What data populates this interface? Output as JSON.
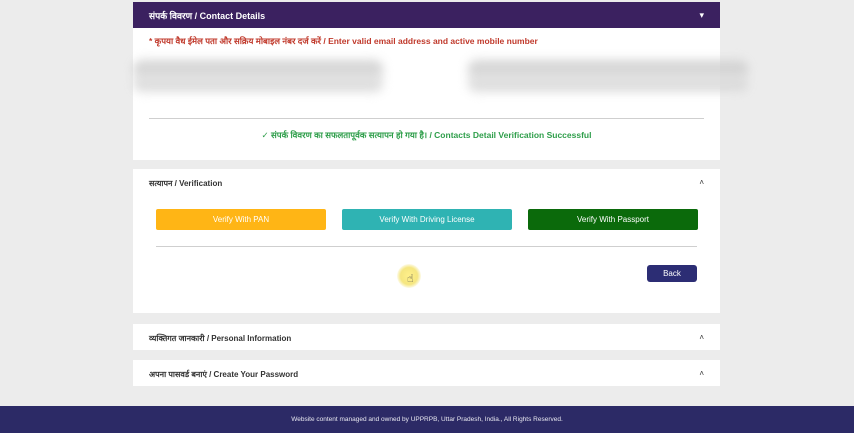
{
  "contact": {
    "header": "संपर्क विवरण / Contact Details",
    "hint": "* कृपया वैध ईमेल पता और सक्रिय मोबाइल नंबर दर्ज करें / Enter valid email address and active mobile number",
    "success": "✓ संपर्क विवरण का सफलतापूर्वक सत्यापन हो गया है। / Contacts Detail Verification Successful"
  },
  "verification": {
    "title": "सत्यापन / Verification",
    "buttons": {
      "pan": "Verify With PAN",
      "driving_license": "Verify With Driving License",
      "passport": "Verify With Passport"
    },
    "back": "Back"
  },
  "accordions": [
    {
      "label": "व्यक्तिगत जानकारी / Personal Information"
    },
    {
      "label": "अपना पासवर्ड बनाएं / Create Your Password"
    }
  ],
  "icons": {
    "chevron_down": "▾",
    "chevron_up": "˄",
    "hand_cursor": "☝"
  },
  "footer": "Website content managed and owned by UPPRPB, Uttar Pradesh, India., All Rights Reserved.",
  "colors": {
    "header": "#3b2160",
    "hint": "#c0392b",
    "success": "#2e9e4a",
    "pan": "#ffb515",
    "driving_license": "#2fb3b3",
    "passport": "#0b6a0b",
    "back": "#2c2d74",
    "footer": "#2c2a66"
  }
}
